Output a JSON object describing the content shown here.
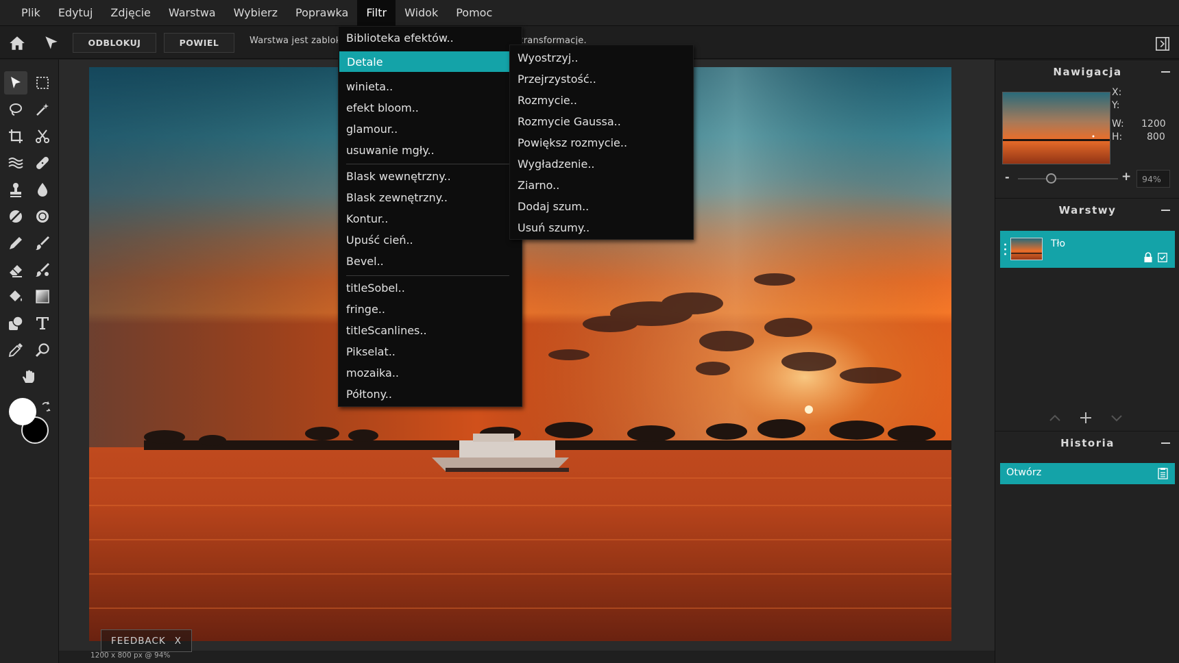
{
  "menubar": {
    "items": [
      "Plik",
      "Edytuj",
      "Zdjęcie",
      "Warstwa",
      "Wybierz",
      "Poprawka",
      "Filtr",
      "Widok",
      "Pomoc"
    ],
    "active": "Filtr"
  },
  "options": {
    "unlock_label": "ODBLOKUJ",
    "duplicate_label": "POWIEL",
    "status_message": "Warstwa jest zablokowana. Kliknij odblokuj, aby umożliwić transformacje."
  },
  "filter_menu": {
    "items": [
      {
        "label": "Biblioteka efektów.."
      },
      {
        "label": "Detale"
      },
      {
        "label": "winieta.."
      },
      {
        "label": "efekt bloom.."
      },
      {
        "label": "glamour.."
      },
      {
        "label": "usuwanie mgły.."
      },
      {
        "label": "Blask wewnętrzny.."
      },
      {
        "label": "Blask zewnętrzny.."
      },
      {
        "label": "Kontur.."
      },
      {
        "label": "Upuść cień.."
      },
      {
        "label": "Bevel.."
      },
      {
        "label": "titleSobel.."
      },
      {
        "label": "fringe.."
      },
      {
        "label": "titleScanlines.."
      },
      {
        "label": "Pikselat.."
      },
      {
        "label": "mozaika.."
      },
      {
        "label": "Półtony.."
      }
    ]
  },
  "detale_submenu": {
    "items": [
      "Wyostrzyj..",
      "Przejrzystość..",
      "Rozmycie..",
      "Rozmycie Gaussa..",
      "Powiększ rozmycie..",
      "Wygładzenie..",
      "Ziarno..",
      "Dodaj szum..",
      "Usuń szumy.."
    ]
  },
  "tools": [
    "move-tool-icon",
    "marquee-select-icon",
    "lasso-icon",
    "magic-wand-icon",
    "crop-icon",
    "scissors-icon",
    "liquify-icon",
    "healing-bandage-icon",
    "clone-stamp-icon",
    "blur-drop-icon",
    "dodge-burn-icon",
    "sponge-icon",
    "pencil-icon",
    "brush-icon",
    "eraser-icon",
    "color-replace-icon",
    "paint-bucket-icon",
    "gradient-icon",
    "shape-icon",
    "text-tool-icon",
    "eyedropper-icon",
    "zoom-icon",
    "hand-icon"
  ],
  "navigator": {
    "title": "Nawigacja",
    "x_label": "X:",
    "y_label": "Y:",
    "w_label": "W:",
    "h_label": "H:",
    "w_value": "1200",
    "h_value": "800",
    "zoom_minus": "-",
    "zoom_plus": "+",
    "zoom_value": "94%",
    "zoom_fraction": 0.33
  },
  "layers": {
    "title": "Warstwy",
    "items": [
      {
        "name": "Tło",
        "locked": true,
        "visible": true
      }
    ]
  },
  "history": {
    "title": "Historia",
    "items": [
      {
        "label": "Otwórz"
      }
    ]
  },
  "canvas": {
    "size_readout": "1200 x 800 px @ 94%"
  },
  "feedback": {
    "label": "FEEDBACK",
    "close": "X"
  },
  "colors": {
    "accent": "#14a3a8",
    "foreground": "#ffffff",
    "background": "#000000"
  }
}
